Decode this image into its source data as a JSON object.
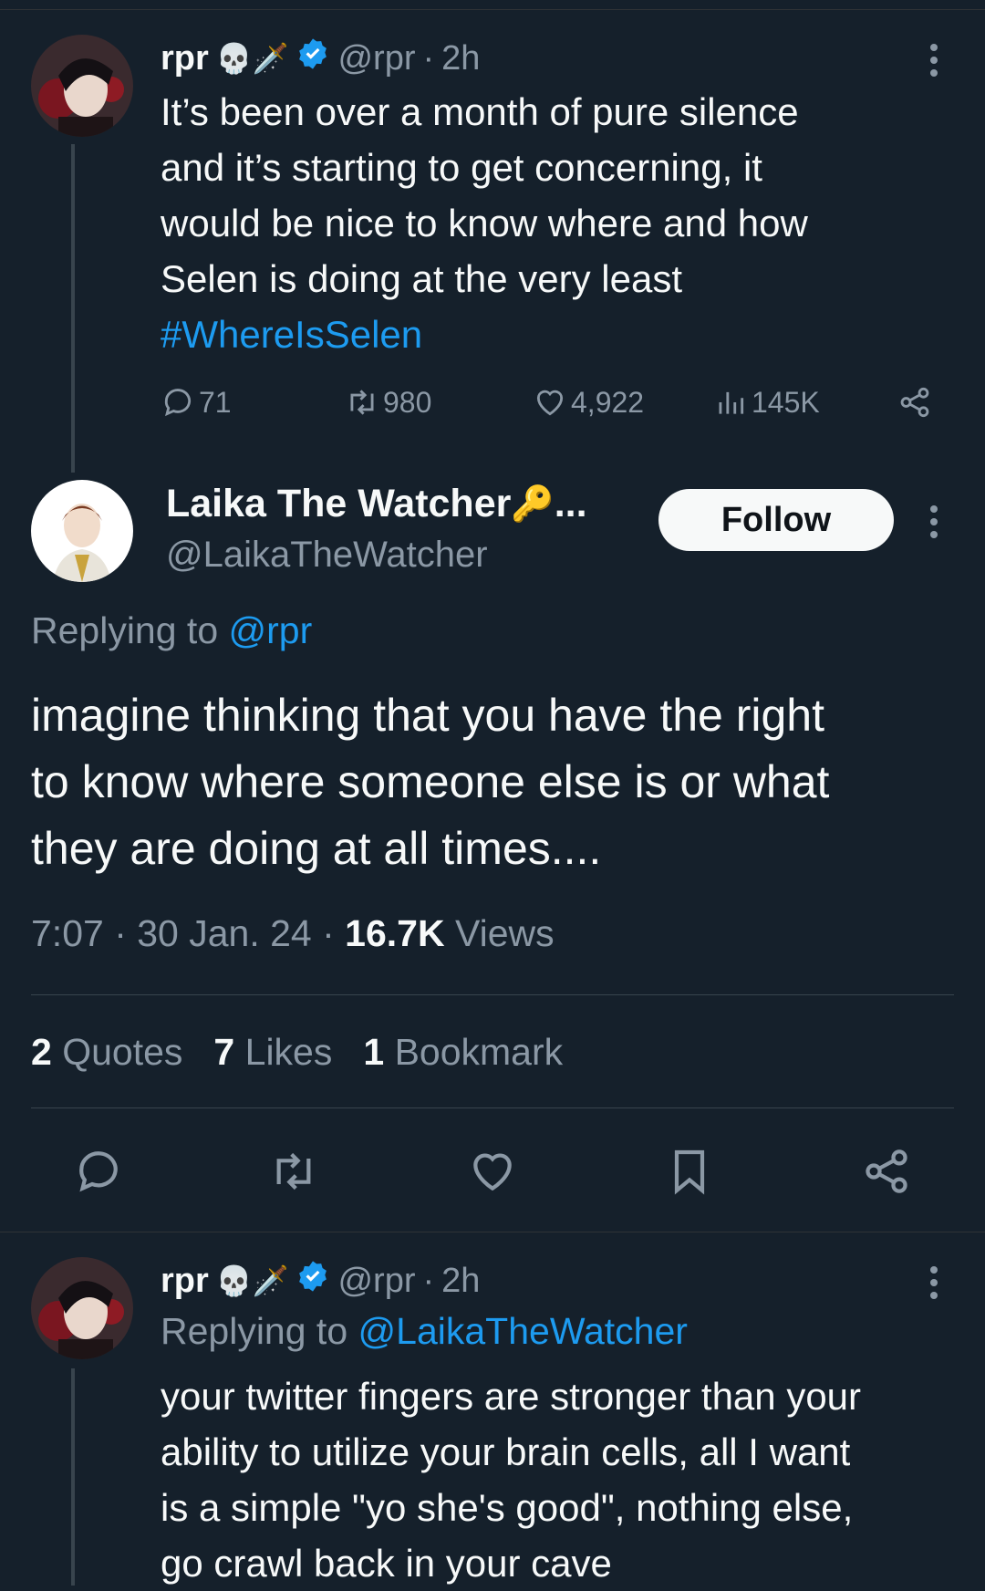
{
  "tweet1": {
    "name": "rpr",
    "name_emojis": "💀🗡️",
    "handle": "@rpr",
    "time": "2h",
    "text_lines": [
      "It’s been over a month of pure silence",
      "and it’s starting to get concerning, it",
      "would be nice to know where and how",
      "Selen is doing at the very least"
    ],
    "hashtag": "#WhereIsSelen",
    "stats": {
      "replies": "71",
      "retweets": "980",
      "likes": "4,922",
      "views": "145K"
    }
  },
  "main": {
    "name": "Laika The Watcher",
    "name_emoji": "🔑",
    "name_ellipsis": "...",
    "handle": "@LaikaTheWatcher",
    "follow_label": "Follow",
    "replying_prefix": "Replying to",
    "replying_handle": "@rpr",
    "text_lines": [
      "imagine thinking that you have the right",
      "to know where someone else is or what",
      "they are doing at all times...."
    ],
    "meta_time": "7:07 · 30 Jan. 24 ·",
    "meta_views_count": "16.7K",
    "meta_views_label": "Views",
    "quotes_count": "2",
    "quotes_label": "Quotes",
    "likes_count": "7",
    "likes_label": "Likes",
    "bookmarks_count": "1",
    "bookmarks_label": "Bookmark"
  },
  "tweet3": {
    "name": "rpr",
    "name_emojis": "💀🗡️",
    "handle": "@rpr",
    "time": "2h",
    "replying_prefix": "Replying to",
    "replying_handle": "@LaikaTheWatcher",
    "text_lines": [
      "your twitter fingers are stronger than your",
      "ability to utilize your brain cells, all I want",
      "is a simple \"yo she's good\", nothing else,",
      "go crawl back in your cave"
    ]
  },
  "colors": {
    "background": "#15202b",
    "text": "#f7f9f9",
    "muted": "#8b98a5",
    "accent": "#1d9bf0"
  },
  "icons": [
    "reply-icon",
    "retweet-icon",
    "like-icon",
    "views-icon",
    "share-icon",
    "bookmark-icon",
    "verified-icon",
    "more-icon"
  ]
}
